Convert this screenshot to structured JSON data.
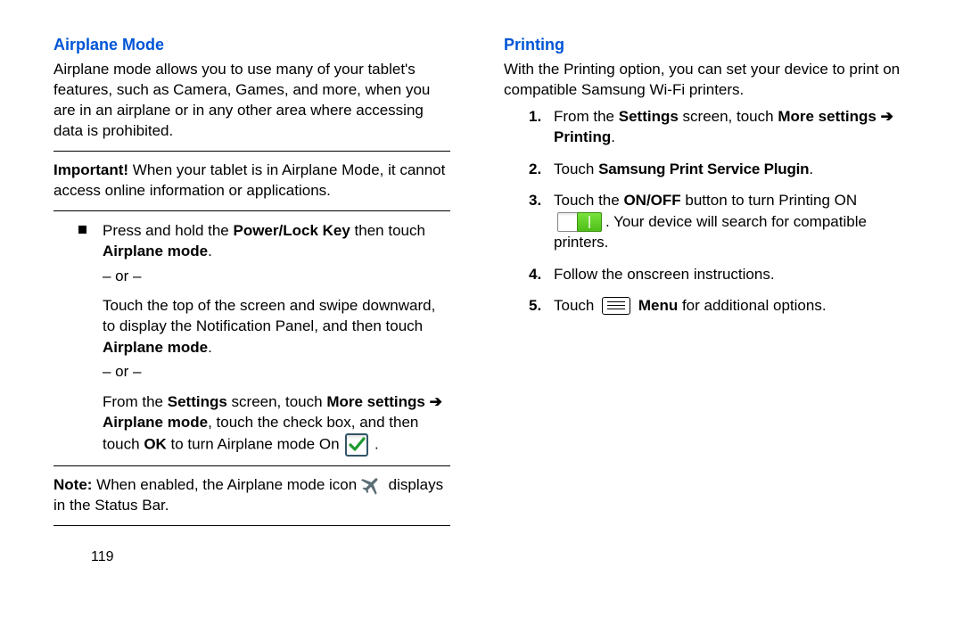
{
  "left": {
    "title": "Airplane Mode",
    "intro": "Airplane mode allows you to use many of your tablet's features, such as Camera, Games, and more, when you are in an airplane or in any other area where accessing data is prohibited.",
    "important_label": "Important!",
    "important_text": "When your tablet is in Airplane Mode, it cannot access online information or applications.",
    "b1_a": "Press and hold the ",
    "b1_b": "Power/Lock Key",
    "b1_c": " then touch ",
    "b1_d": "Airplane mode",
    "b1_e": ".",
    "or": "– or –",
    "b2_a": "Touch the top of the screen and swipe downward, to display the Notification Panel, and then touch ",
    "b2_b": "Airplane mode",
    "b2_c": ".",
    "b3_a": "From the ",
    "b3_b": "Settings",
    "b3_c": " screen, touch ",
    "b3_d": "More settings",
    "b3_arrow": " ➔ ",
    "b3_e": "Airplane mode",
    "b3_f": ", touch the check box, and then touch ",
    "b3_g": "OK",
    "b3_h": " to turn Airplane mode On ",
    "b3_i": ".",
    "note_label": "Note:",
    "note_a": " When enabled, the Airplane mode icon ",
    "note_b": " displays in the Status Bar.",
    "pageno": "119"
  },
  "right": {
    "title": "Printing",
    "intro": "With the Printing option, you can set your device to print on compatible Samsung Wi-Fi printers.",
    "s1_a": "From the ",
    "s1_b": "Settings",
    "s1_c": " screen, touch ",
    "s1_d": "More settings",
    "s1_arrow": " ➔ ",
    "s1_e": "Printing",
    "s1_f": ".",
    "s2_a": "Touch ",
    "s2_b": "Samsung Print Service Plugin",
    "s2_c": ".",
    "s3_a": "Touch the ",
    "s3_b": "ON/OFF",
    "s3_c": " button to turn Printing ON ",
    "s3_d": ". Your device will search for compatible printers.",
    "s4": "Follow the onscreen instructions.",
    "s5_a": "Touch ",
    "s5_b": "Menu",
    "s5_c": " for additional options."
  }
}
